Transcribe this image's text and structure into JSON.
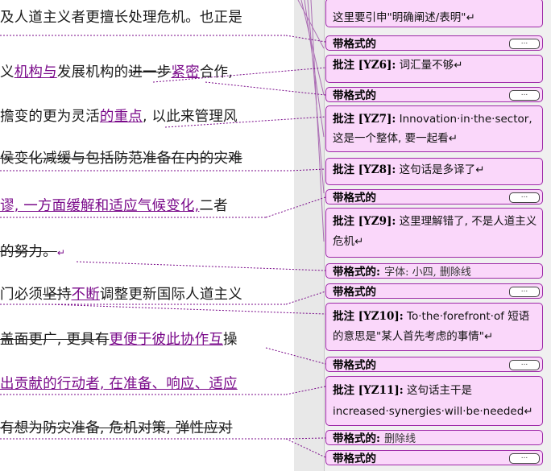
{
  "doc": {
    "lines": [
      {
        "parts": [
          {
            "t": "及人道主义者更擅长处理危机。也正是",
            "s": "n"
          }
        ]
      },
      {
        "parts": [
          {
            "t": "义",
            "s": "n"
          },
          {
            "t": "机构与",
            "s": "ins"
          },
          {
            "t": "发展机构的",
            "s": "n"
          },
          {
            "t": "进一步",
            "s": "del"
          },
          {
            "t": "紧密",
            "s": "ins"
          },
          {
            "t": "合作,",
            "s": "n"
          }
        ]
      },
      {
        "parts": [
          {
            "t": "擔变的更为灵活",
            "s": "n"
          },
          {
            "t": "的重点",
            "s": "ins"
          },
          {
            "t": ",  以此来管理风",
            "s": "n"
          }
        ]
      },
      {
        "parts": [
          {
            "t": "侯变化减缓与包括防范准备在内的灾难",
            "s": "del"
          }
        ]
      },
      {
        "parts": [
          {
            "t": "谬, 一方面缓解和适应气候变化,",
            "s": "ins"
          },
          {
            "t": "二者",
            "s": "n"
          }
        ]
      },
      {
        "parts": [
          {
            "t": "的努力。",
            "s": "del"
          },
          {
            "t": "↵",
            "s": "mark"
          }
        ]
      },
      {
        "parts": [
          {
            "t": "门必须",
            "s": "n"
          },
          {
            "t": "坚持",
            "s": "del"
          },
          {
            "t": "不断",
            "s": "ins"
          },
          {
            "t": "调整更新国际人道主义",
            "s": "n"
          }
        ]
      },
      {
        "parts": [
          {
            "t": "盖面更广, 更具有",
            "s": "del"
          },
          {
            "t": "更便于彼此协作互",
            "s": "ins"
          },
          {
            "t": "操",
            "s": "n"
          }
        ]
      },
      {
        "parts": [
          {
            "t": "出贡献的行动者, 在准备、响应、适应",
            "s": "ins"
          }
        ]
      },
      {
        "parts": [
          {
            "t": "有想为防灾准备, 危机对策, 弹性应对",
            "s": "del"
          }
        ]
      }
    ]
  },
  "balloons": [
    {
      "kind": "comment",
      "text": "这里要引申\"明确阐述/表明\"↵",
      "partial": true
    },
    {
      "kind": "format",
      "label": "带格式的",
      "detail": "",
      "button": "..."
    },
    {
      "kind": "comment",
      "label": "批注 [YZ6]:",
      "text": "词汇量不够↵"
    },
    {
      "kind": "format",
      "label": "带格式的",
      "detail": "",
      "button": "..."
    },
    {
      "kind": "comment",
      "label": "批注 [YZ7]:",
      "text": "Innovation·in·the·sector, 这是一个整体, 要一起看↵"
    },
    {
      "kind": "comment",
      "label": "批注 [YZ8]:",
      "text": "这句话是多译了↵"
    },
    {
      "kind": "format",
      "label": "带格式的",
      "detail": "",
      "button": "..."
    },
    {
      "kind": "comment",
      "label": "批注 [YZ9]:",
      "text": "这里理解错了, 不是人道主义危机↵"
    },
    {
      "kind": "format",
      "label": "带格式的:",
      "detail": "字体: 小四, 删除线",
      "button": ""
    },
    {
      "kind": "format",
      "label": "带格式的",
      "detail": "",
      "button": "..."
    },
    {
      "kind": "comment",
      "label": "批注 [YZ10]:",
      "text": "To·the·forefront·of 短语的意思是\"某人首先考虑的事情\"↵"
    },
    {
      "kind": "format",
      "label": "带格式的",
      "detail": "",
      "button": "..."
    },
    {
      "kind": "comment",
      "label": "批注 [YZ11]:",
      "text": "这句话主干是 increased·synergies·will·be·needed↵"
    },
    {
      "kind": "format",
      "label": "带格式的:",
      "detail": "删除线",
      "button": ""
    },
    {
      "kind": "format",
      "label": "带格式的",
      "detail": "",
      "button": "..."
    }
  ],
  "colors": {
    "markup": "#7a0a8a",
    "balloon_bg": "#fad7fa",
    "balloon_border": "#9e2aa8"
  }
}
